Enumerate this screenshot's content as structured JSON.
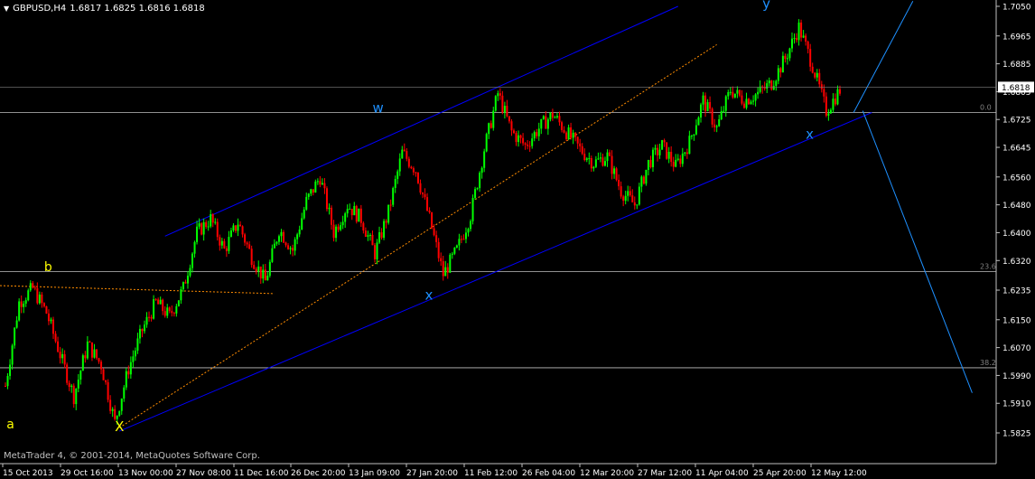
{
  "header": {
    "symbol": "GBPUSD,H4",
    "ohlc": "1.6817 1.6825 1.6816 1.6818"
  },
  "copyright": "MetaTrader 4, © 2001-2014, MetaQuotes Software Corp.",
  "colors": {
    "background": "#000000",
    "bull": "#00ff00",
    "bear": "#ff0000",
    "grid": "#c0c0c0",
    "channel": "#0000ff",
    "median": "#ff8c00",
    "wave_label": "#1e90ff",
    "wave_label_yellow": "#ffff00",
    "projection": "#1e90ff"
  },
  "chart_data": {
    "type": "candlestick",
    "title": "GBPUSD,H4",
    "ylim": [
      1.5825,
      1.7055
    ],
    "y_ticks": [
      "1.7050",
      "1.6965",
      "1.6885",
      "1.6805",
      "1.6725",
      "1.6645",
      "1.6560",
      "1.6480",
      "1.6400",
      "1.6320",
      "1.6235",
      "1.6150",
      "1.6070",
      "1.5990",
      "1.5910",
      "1.5825"
    ],
    "current_price": "1.6818",
    "x_ticks": [
      "15 Oct 2013",
      "29 Oct 16:00",
      "13 Nov 00:00",
      "27 Nov 08:00",
      "11 Dec 16:00",
      "26 Dec 20:00",
      "13 Jan 09:00",
      "27 Jan 20:00",
      "11 Feb 12:00",
      "26 Feb 04:00",
      "12 Mar 20:00",
      "27 Mar 12:00",
      "11 Apr 04:00",
      "25 Apr 20:00",
      "12 May 12:00"
    ],
    "fib_levels": [
      {
        "label": "0.0",
        "value": 1.6745
      },
      {
        "label": "23.6",
        "value": 1.6288
      },
      {
        "label": "38.2",
        "value": 1.6012
      }
    ],
    "wave_labels": [
      "a",
      "b",
      "X",
      "w",
      "x",
      "y",
      "x"
    ],
    "price_path": [
      {
        "i": 0,
        "p": 1.596
      },
      {
        "i": 6,
        "p": 1.62
      },
      {
        "i": 12,
        "p": 1.624
      },
      {
        "i": 18,
        "p": 1.617
      },
      {
        "i": 24,
        "p": 1.605
      },
      {
        "i": 30,
        "p": 1.593
      },
      {
        "i": 36,
        "p": 1.608
      },
      {
        "i": 42,
        "p": 1.602
      },
      {
        "i": 48,
        "p": 1.5855
      },
      {
        "i": 54,
        "p": 1.601
      },
      {
        "i": 60,
        "p": 1.612
      },
      {
        "i": 66,
        "p": 1.62
      },
      {
        "i": 72,
        "p": 1.616
      },
      {
        "i": 78,
        "p": 1.624
      },
      {
        "i": 84,
        "p": 1.64
      },
      {
        "i": 90,
        "p": 1.644
      },
      {
        "i": 96,
        "p": 1.635
      },
      {
        "i": 102,
        "p": 1.643
      },
      {
        "i": 108,
        "p": 1.633
      },
      {
        "i": 114,
        "p": 1.626
      },
      {
        "i": 120,
        "p": 1.641
      },
      {
        "i": 126,
        "p": 1.635
      },
      {
        "i": 132,
        "p": 1.649
      },
      {
        "i": 138,
        "p": 1.656
      },
      {
        "i": 144,
        "p": 1.64
      },
      {
        "i": 150,
        "p": 1.648
      },
      {
        "i": 156,
        "p": 1.644
      },
      {
        "i": 162,
        "p": 1.634
      },
      {
        "i": 168,
        "p": 1.646
      },
      {
        "i": 174,
        "p": 1.663
      },
      {
        "i": 180,
        "p": 1.658
      },
      {
        "i": 186,
        "p": 1.644
      },
      {
        "i": 192,
        "p": 1.628
      },
      {
        "i": 198,
        "p": 1.635
      },
      {
        "i": 204,
        "p": 1.645
      },
      {
        "i": 210,
        "p": 1.664
      },
      {
        "i": 216,
        "p": 1.68
      },
      {
        "i": 222,
        "p": 1.669
      },
      {
        "i": 228,
        "p": 1.665
      },
      {
        "i": 234,
        "p": 1.67
      },
      {
        "i": 240,
        "p": 1.674
      },
      {
        "i": 246,
        "p": 1.669
      },
      {
        "i": 252,
        "p": 1.664
      },
      {
        "i": 258,
        "p": 1.66
      },
      {
        "i": 264,
        "p": 1.662
      },
      {
        "i": 270,
        "p": 1.652
      },
      {
        "i": 276,
        "p": 1.648
      },
      {
        "i": 282,
        "p": 1.66
      },
      {
        "i": 288,
        "p": 1.665
      },
      {
        "i": 294,
        "p": 1.659
      },
      {
        "i": 300,
        "p": 1.666
      },
      {
        "i": 306,
        "p": 1.678
      },
      {
        "i": 312,
        "p": 1.67
      },
      {
        "i": 318,
        "p": 1.681
      },
      {
        "i": 324,
        "p": 1.678
      },
      {
        "i": 330,
        "p": 1.68
      },
      {
        "i": 336,
        "p": 1.683
      },
      {
        "i": 342,
        "p": 1.69
      },
      {
        "i": 348,
        "p": 1.699
      },
      {
        "i": 354,
        "p": 1.688
      },
      {
        "i": 360,
        "p": 1.675
      },
      {
        "i": 366,
        "p": 1.681
      }
    ]
  }
}
